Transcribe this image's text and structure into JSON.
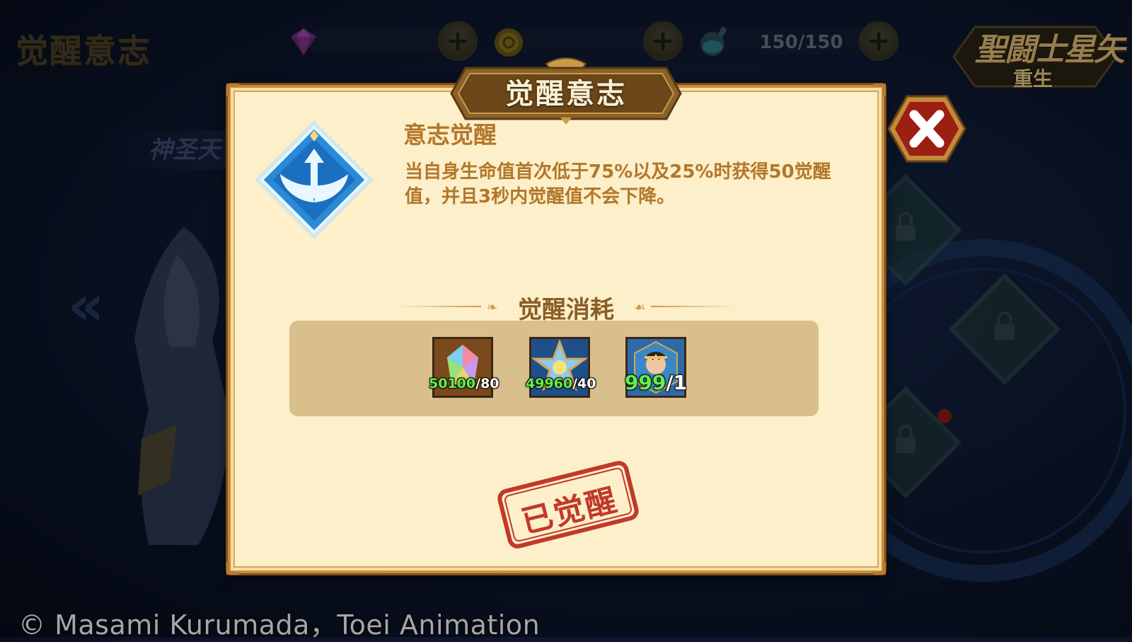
{
  "background": {
    "page_title": "觉醒意志",
    "tab_label": "神圣天",
    "copyright": "© Masami Kurumada，Toei Animation",
    "logo": {
      "title": "聖闘士星矢",
      "subtitle": "重生"
    }
  },
  "currency": {
    "gem": {
      "value": "",
      "icon": "purple-gem-icon"
    },
    "gold": {
      "value": "",
      "icon": "gold-coin-icon"
    },
    "stamina": {
      "value": "150/150",
      "icon": "stamina-flask-icon"
    },
    "plus_label": "+"
  },
  "modal": {
    "title": "觉醒意志",
    "skill": {
      "name": "意志觉醒",
      "description": "当自身生命值首次低于75%以及25%时获得50觉醒值，并且3秒内觉醒值不会下降。"
    },
    "cost_title": "觉醒消耗",
    "cost_items": [
      {
        "icon": "rainbow-crystal-icon",
        "have": "50100",
        "need": "80"
      },
      {
        "icon": "star-medal-icon",
        "have": "49960",
        "need": "40"
      },
      {
        "icon": "saint-portrait-icon",
        "have": "999",
        "need": "1"
      }
    ],
    "stamp_text": "已觉醒"
  },
  "colors": {
    "modal_bg": "#fcefc9",
    "accent_text": "#b2772a",
    "have_count": "#5ef050",
    "stamp_red": "#c1392b"
  }
}
